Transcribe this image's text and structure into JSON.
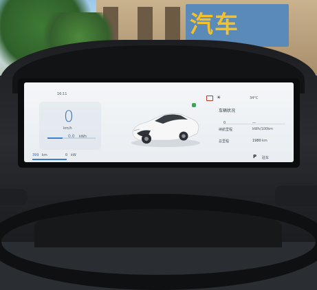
{
  "cluster": {
    "time": "16:11",
    "outside_temp": "34°C",
    "speed": "0",
    "speed_unit": "km/h",
    "trip_value": "0.0",
    "trip_unit": "kWh",
    "range": "399",
    "range_unit": "km",
    "panel_title": "车辆状况",
    "mileage_label": "续航里程",
    "mileage_value": "0",
    "energy_label": "能耗",
    "energy_value": "—",
    "mileage_unit": "km",
    "energy_unit": "kWh/100km",
    "odo_label": "总里程",
    "odo_value": "1980",
    "odo_unit": "km",
    "gear": "P",
    "gear_label": "驻车",
    "power_value": "0",
    "power_unit": "kW"
  },
  "storefront_sign": "汽车",
  "colors": {
    "screen_bg": "#f0f3f6",
    "accent_blue": "#3a7fd0",
    "car_white": "#f7f7f7",
    "warning_red": "#c0392b"
  }
}
